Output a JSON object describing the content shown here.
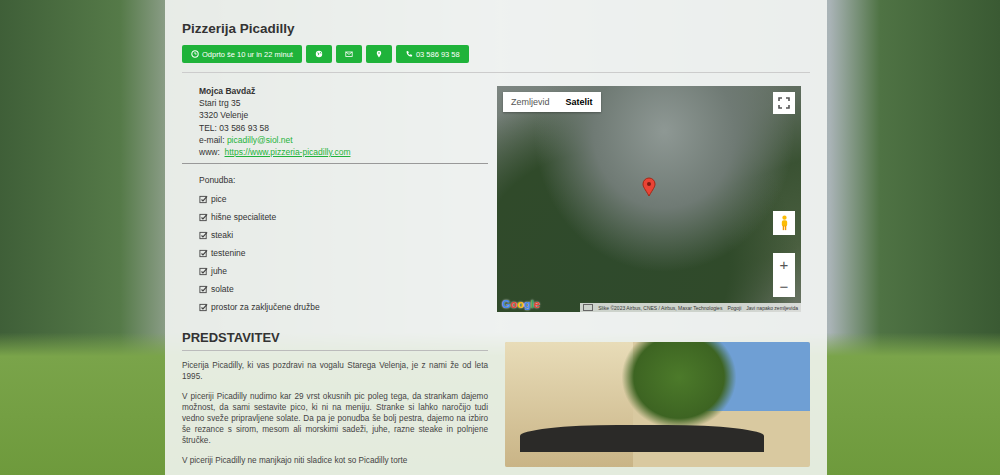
{
  "listing": {
    "title": "Pizzerija Picadilly"
  },
  "actions": [
    {
      "kind": "status",
      "label": "Odprto še 10 ur in 22 minut"
    },
    {
      "kind": "web",
      "label": ""
    },
    {
      "kind": "email",
      "label": ""
    },
    {
      "kind": "location",
      "label": ""
    },
    {
      "kind": "phone",
      "label": "03 586 93 58"
    }
  ],
  "contact": {
    "name": "Mojca Bavdaž",
    "street": "Stari trg 35",
    "city": "3320 Velenje",
    "phone_line": "TEL: 03 586 93 58",
    "email_label": "e-mail:",
    "email": "picadilly@siol.net",
    "web_label": "www:",
    "web": "https://www.pizzeria-picadilly.com"
  },
  "offer": {
    "title": "Ponudba:",
    "items": [
      {
        "label": "pice",
        "checked": true
      },
      {
        "label": "hišne specialitete",
        "checked": true
      },
      {
        "label": "steaki",
        "checked": true
      },
      {
        "label": "testenine",
        "checked": true
      },
      {
        "label": "juhe",
        "checked": true
      },
      {
        "label": "solate",
        "checked": true
      },
      {
        "label": "prostor za zaključene družbe",
        "checked": true
      }
    ]
  },
  "map": {
    "types": [
      {
        "label": "Zemljevid",
        "selected": false
      },
      {
        "label": "Satelit",
        "selected": true
      }
    ],
    "logo": "Google",
    "attribution": "Slike ©2023 Airbus, CNES / Airbus, Maxar Technologies",
    "links": [
      "Pogoji",
      "Javi napako zemljevida"
    ],
    "zoom_in": "+",
    "zoom_out": "−"
  },
  "intro": {
    "title": "PREDSTAVITEV",
    "paragraphs": [
      "Picerija Picadilly, ki vas pozdravi na vogalu Starega Velenja, je z nami že od leta 1995.",
      "V piceriji Picadilly nudimo kar 29 vrst okusnih pic poleg tega, da strankam dajemo možnost, da sami sestavite pico, ki ni na meniju. Stranke si lahko naročijo tudi vedno sveže pripravljene solate. Da pa je ponudba še bolj pestra, dajemo na izbiro še rezance s sirom, mesom ali morskimi sadeži, juhe, razne steake in polnjene štručke.",
      "V piceriji Picadilly ne manjkajo niti sladice kot so Picadilly torte"
    ]
  }
}
